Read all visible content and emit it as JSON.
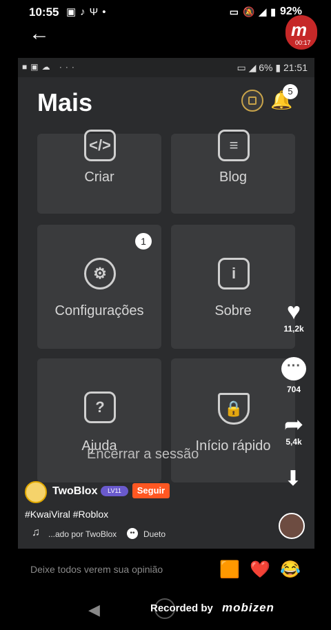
{
  "status_bar": {
    "time": "10:55",
    "left_icons": [
      "image-icon",
      "tiktok-icon",
      "signal-app-icon",
      "dot-icon"
    ],
    "battery": "92%"
  },
  "recording_badge": {
    "logo": "m",
    "time": "00:17"
  },
  "inner_status": {
    "battery": "6%",
    "time": "21:51"
  },
  "header": {
    "title": "Mais",
    "notification_count": "5"
  },
  "tiles": [
    {
      "label": "Criar",
      "icon": "code-icon"
    },
    {
      "label": "Blog",
      "icon": "blog-icon"
    },
    {
      "label": "Configurações",
      "icon": "gear-icon",
      "badge": "1"
    },
    {
      "label": "Sobre",
      "icon": "info-icon"
    },
    {
      "label": "Ajuda",
      "icon": "help-icon"
    },
    {
      "label": "Início rápido",
      "icon": "lock-shield-icon"
    }
  ],
  "logout": "Encerrar a sessão",
  "actions": {
    "likes": "11,2k",
    "comments": "704",
    "shares": "5,4k"
  },
  "post": {
    "username": "TwoBlox",
    "level": "LV11",
    "follow_label": "Seguir",
    "hashtags": "#KwaiViral #Roblox",
    "music": "...ado por TwoBlox",
    "duet_label": "Dueto"
  },
  "comment_bar": {
    "placeholder": "Deixe todos verem sua opinião"
  },
  "recorder": {
    "recorded_by": "Recorded by",
    "brand": "mobizen"
  }
}
